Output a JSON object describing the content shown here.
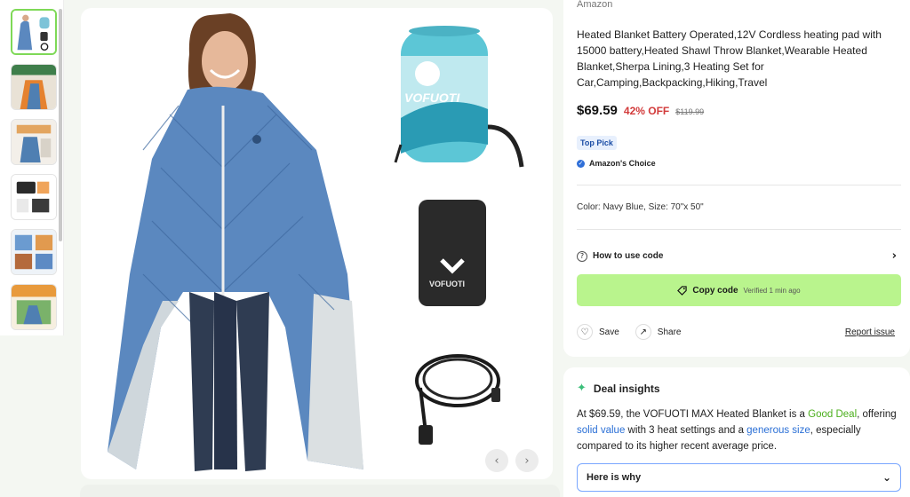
{
  "thumbnails": [
    "thumb-1",
    "thumb-2",
    "thumb-3",
    "thumb-4",
    "thumb-5",
    "thumb-6"
  ],
  "product_image": {
    "pouch_brand_text": "VOFUOTI",
    "battery_brand_text": "VOFUOTI"
  },
  "nav": {
    "prev_icon": "chevron-left-icon",
    "next_icon": "chevron-right-icon"
  },
  "info": {
    "brand": "Amazon",
    "title": "Heated Blanket Battery Operated,12V Cordless heating pad with 15000 battery,Heated Shawl Throw Blanket,Wearable Heated Blanket,Sherpa Lining,3 Heating Set for Car,Camping,Backpacking,Hiking,Travel",
    "price": "$69.59",
    "discount": "42% OFF",
    "original_price": "$119.99",
    "badge_top_pick": "Top Pick",
    "badge_choice": "Amazon's Choice",
    "variant": "Color: Navy Blue, Size: 70\"x 50\"",
    "how_to_use": "How to use code",
    "copy_code": "Copy code",
    "verified": "Verified 1 min ago",
    "save": "Save",
    "share": "Share",
    "report": "Report issue"
  },
  "insights": {
    "heading": "Deal insights",
    "text_1": "At $69.59, the VOFUOTI MAX Heated Blanket is a ",
    "good_deal": "Good Deal",
    "text_2": ", offering ",
    "solid_value": "solid value",
    "text_3": " with 3 heat settings and a ",
    "generous_size": "generous size",
    "text_4": ", especially compared to its higher recent average price.",
    "why": "Here is why"
  },
  "colors": {
    "accent_green": "#b9f48d",
    "discount_red": "#d23b3b",
    "good_deal_green": "#4caf1d",
    "link_blue": "#2a6fd6",
    "active_thumb_border": "#7ed957"
  }
}
